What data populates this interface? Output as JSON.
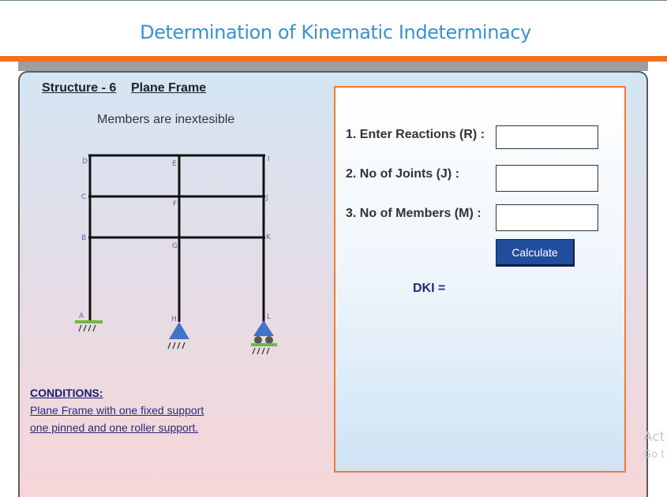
{
  "header": {
    "title": "Determination of Kinematic Indeterminacy"
  },
  "structure": {
    "heading_number": "Structure - 6",
    "heading_type": "Plane Frame",
    "note": "Members are inextesible",
    "joint_labels": [
      "A",
      "B",
      "C",
      "D",
      "E",
      "F",
      "G",
      "H",
      "I",
      "J",
      "K",
      "L"
    ]
  },
  "conditions": {
    "heading": "CONDITIONS:",
    "line1": "Plane Frame with one fixed support",
    "line2": "one pinned and one roller support."
  },
  "form": {
    "reactions_label": "1. Enter Reactions (R) :",
    "reactions_value": "",
    "joints_label": "2. No of Joints (J) :",
    "joints_value": "",
    "members_label": "3. No of Members (M) :",
    "members_value": "",
    "calculate_label": "Calculate",
    "result_label": "DKI ="
  },
  "watermark": {
    "line1": "Act",
    "line2": "Go t"
  },
  "colors": {
    "accent": "#f36f21",
    "title": "#3a92c9",
    "button": "#204d9c",
    "support": "#3f74c6",
    "ground": "#6fb83f"
  }
}
